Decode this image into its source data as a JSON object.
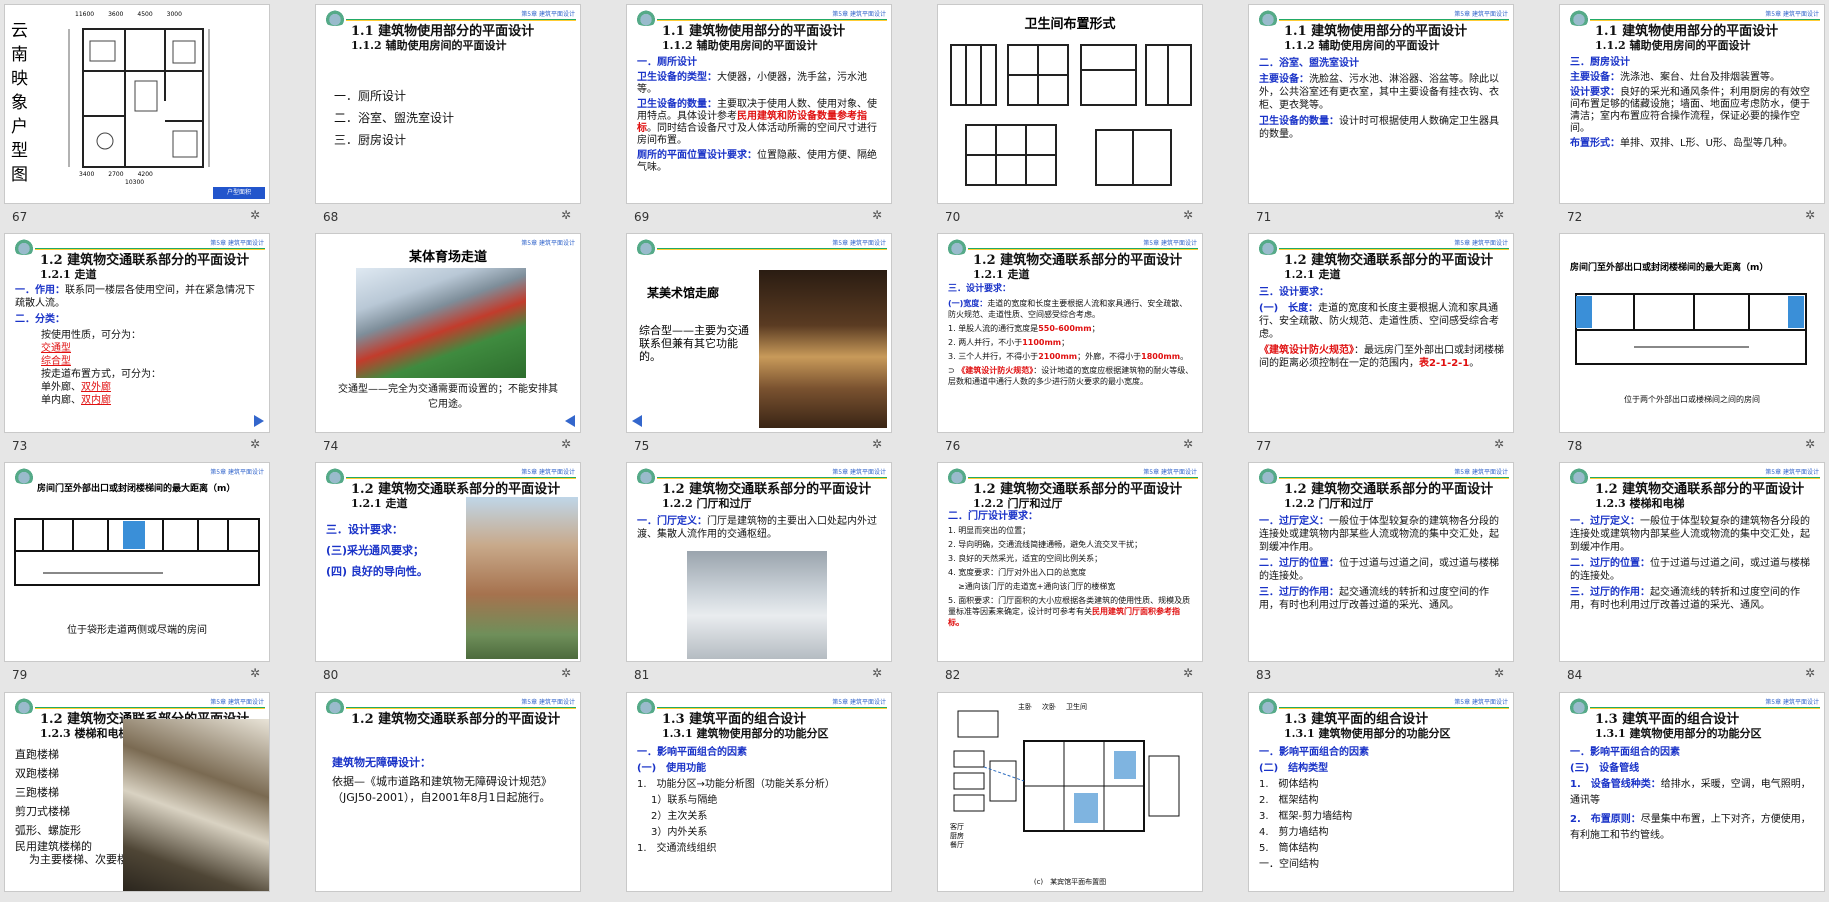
{
  "header_text": "第5章 建筑平面设计",
  "slides": {
    "s67": {
      "num": "67",
      "vtitle": "云南映象户型图",
      "dims_top": [
        "11600",
        "3600",
        "4500",
        "3000"
      ],
      "dims_bottom": [
        "3400",
        "2700",
        "4200",
        "10300"
      ],
      "badge": "户型面积"
    },
    "s68": {
      "num": "68",
      "t1": "1.1 建筑物使用部分的平面设计",
      "t2": "1.1.2 辅助使用房间的平面设计",
      "items": [
        "一．厕所设计",
        "二．浴室、盥洗室设计",
        "三．厨房设计"
      ]
    },
    "s69": {
      "num": "69",
      "t1": "1.1 建筑物使用部分的平面设计",
      "t2": "1.1.2 辅助使用房间的平面设计",
      "h": "一．厕所设计",
      "l1a": "卫生设备的类型：",
      "l1b": "大便器，小便器，洗手盆，污水池等。",
      "l2a": "卫生设备的数量：",
      "l2b": "主要取决于使用人数、使用对象、使用特点。具体设计参考",
      "l2c": "民用建筑和防设备数量参考指标",
      "l2d": "。同时结合设备尺寸及人体活动所需的空间尺寸进行房间布置。",
      "l3a": "厕所的平面位置设计要求：",
      "l3b": "位置隐蔽、使用方便、隔绝气味。"
    },
    "s70": {
      "num": "70",
      "title": "卫生间布置形式"
    },
    "s71": {
      "num": "71",
      "t1": "1.1 建筑物使用部分的平面设计",
      "t2": "1.1.2 辅助使用房间的平面设计",
      "h": "二．浴室、盥洗室设计",
      "l1a": "主要设备：",
      "l1b": "洗脸盆、污水池、淋浴器、浴盆等。除此以外，公共浴室还有更衣室，其中主要设备有挂衣钩、衣柜、更衣凳等。",
      "l2a": "卫生设备的数量：",
      "l2b": "设计时可根据使用人数确定卫生器具的数量。"
    },
    "s72": {
      "num": "72",
      "t1": "1.1 建筑物使用部分的平面设计",
      "t2": "1.1.2 辅助使用房间的平面设计",
      "h": "三．厨房设计",
      "l1a": "主要设备：",
      "l1b": "洗涤池、案台、灶台及排烟装置等。",
      "l2a": "设计要求：",
      "l2b": "良好的采光和通风条件；利用厨房的有效空间布置足够的储藏设施；墙面、地面应考虑防水，便于清洁；室内布置应符合操作流程，保证必要的操作空间。",
      "l3a": "布置形式：",
      "l3b": "单排、双排、L形、U形、岛型等几种。"
    },
    "s73": {
      "num": "73",
      "t1": "1.2 建筑物交通联系部分的平面设计",
      "t2": "1.2.1 走道",
      "h1": "一．作用：",
      "h1b": "联系同一楼层各使用空间，并在紧急情况下疏散人流。",
      "h2": "二．分类：",
      "p1": "按使用性质，可分为：",
      "a1": "交通型",
      "a2": "综合型",
      "p2": "按走道布置方式，可分为：",
      "p3a": "单外廊、",
      "p3b": "双外廊",
      "p4a": "单内廊、",
      "p4b": "双内廊"
    },
    "s74": {
      "num": "74",
      "title": "某体育场走道",
      "cap": "交通型——完全为交通需要而设置的；不能安排其它用途。"
    },
    "s75": {
      "num": "75",
      "title": "某美术馆走廊",
      "cap": "综合型——主要为交通联系但兼有其它功能的。"
    },
    "s76": {
      "num": "76",
      "t1": "1.2 建筑物交通联系部分的平面设计",
      "t2": "1.2.1 走道",
      "h": "三．设计要求：",
      "p0a": "(一)宽度：",
      "p0b": "走道的宽度和长度主要根据人流和家具通行、安全疏散、防火规范、走道性质、空间感受综合考虑。",
      "l1a": "单股人流的通行宽度是",
      "l1b": "550-600mm",
      "l1c": "；",
      "l2a": "两人并行，不小于",
      "l2b": "1100mm",
      "l2c": "；",
      "l3a": "三个人并行，不得小于",
      "l3b": "2100mm",
      "l3c": "；外廊，不得小于",
      "l3d": "1800mm",
      "l3e": "。",
      "n1a": "《建筑设计防火规范》",
      "n1b": "：设计地道的宽度应根据建筑物的耐火等级、层数和通道中通行人数的多少进行防火要求的最小宽度。"
    },
    "s77": {
      "num": "77",
      "t1": "1.2 建筑物交通联系部分的平面设计",
      "t2": "1.2.1 走道",
      "h": "三．设计要求：",
      "p1a": "(一)　长度：",
      "p1b": "走道的宽度和长度主要根据人流和家具通行、安全疏散、防火规范、走道性质、空间感受综合考虑。",
      "p2a": "《建筑设计防火规范》",
      "p2b": "：最远房门至外部出口或封闭楼梯间的距离必须控制在一定的范围内，",
      "p2c": "表2-1-2-1",
      "p2d": "。"
    },
    "s78": {
      "num": "78",
      "title": "房间门至外部出口或封闭楼梯间的最大距离（m）",
      "cap": "位于两个外部出口或楼梯间之间的房间"
    },
    "s79": {
      "num": "79",
      "title": "房间门至外部出口或封闭楼梯间的最大距离（m）",
      "cap": "位于袋形走道两侧或尽端的房间"
    },
    "s80": {
      "num": "80",
      "t1": "1.2 建筑物交通联系部分的平面设计",
      "t2": "1.2.1 走道",
      "h": "三．设计要求：",
      "p1": "(三)采光通风要求；",
      "p2": "(四) 良好的导向性。"
    },
    "s81": {
      "num": "81",
      "t1": "1.2 建筑物交通联系部分的平面设计",
      "t2": "1.2.2 门厅和过厅",
      "h": "一．门厅定义：",
      "hb": "门厅是建筑物的主要出入口处起内外过渡、集散人流作用的交通枢纽。"
    },
    "s82": {
      "num": "82",
      "t1": "1.2 建筑物交通联系部分的平面设计",
      "t2": "1.2.2 门厅和过厅",
      "h": "二．门厅设计要求：",
      "items": [
        "明显而突出的位置；",
        "导向明确，交通流线简捷通畅，避免人流交叉干扰；",
        "良好的天然采光，适宜的空间比例关系；",
        "宽度要求：门厅对外出入口的总宽度",
        "≥通向该门厅的走道宽+通向该门厅的楼梯宽",
        "面积要求：门厅面积的大小应根据各类建筑的使用性质、规模及质量标准等因素来确定，设计时可参考有关"
      ],
      "red": "民用建筑门厅面积参考指标。"
    },
    "s83": {
      "num": "83",
      "t1": "1.2 建筑物交通联系部分的平面设计",
      "t2": "1.2.2 门厅和过厅",
      "a1": "一．过厅定义：",
      "a1b": "一般位于体型较复杂的建筑物各分段的连接处或建筑物内部某些人流或物流的集中交汇处，起到缓冲作用。",
      "a2": "二．过厅的位置：",
      "a2b": "位于过道与过道之间，或过道与楼梯的连接处。",
      "a3": "三．过厅的作用：",
      "a3b": "起交通流线的转折和过度空间的作用，有时也利用过厅改善过道的采光、通风。"
    },
    "s84": {
      "num": "84",
      "t1": "1.2 建筑物交通联系部分的平面设计",
      "t2": "1.2.3 楼梯和电梯",
      "a1": "一．过厅定义：",
      "a1b": "一般位于体型较复杂的建筑物各分段的连接处或建筑物内部某些人流或物流的集中交汇处，起到缓冲作用。",
      "a2": "二．过厅的位置：",
      "a2b": "位于过道与过道之间，或过道与楼梯的连接处。",
      "a3": "三．过厅的作用：",
      "a3b": "起交通流线的转折和过度空间的作用，有时也利用过厅改善过道的采光、通风。"
    },
    "s85": {
      "t1": "1.2 建筑物交通联系部分的平面设计",
      "t2": "1.2.3 楼梯和电梯",
      "items": [
        "直跑楼梯",
        "双跑楼梯",
        "三跑楼梯",
        "剪刀式楼梯",
        "弧形、螺旋形",
        "民用建筑楼梯的",
        "为主要楼梯、次要楼"
      ]
    },
    "s86": {
      "t1": "1.2 建筑物交通联系部分的平面设计",
      "h": "建筑物无障碍设计：",
      "p": "依据—《城市道路和建筑物无障碍设计规范》（JGJ50-2001），自2001年8月1日起施行。"
    },
    "s87": {
      "t1": "1.3 建筑平面的组合设计",
      "t2": "1.3.1 建筑物使用部分的功能分区",
      "h": "一．影响平面组合的因素",
      "h2": "(一)　使用功能",
      "items": [
        "1.　功能分区→功能分析图（功能关系分析）",
        "1）联系与隔绝",
        "2）主次关系",
        "3）内外关系",
        "1.　交通流线组织"
      ]
    },
    "s88": {
      "labels": [
        "客厅",
        "厨房",
        "餐厅",
        "主卧",
        "次卧",
        "卫生间"
      ],
      "cap": "(c)　某宾馆平面布置图"
    },
    "s89": {
      "t1": "1.3 建筑平面的组合设计",
      "t2": "1.3.1 建筑物使用部分的功能分区",
      "h": "一．影响平面组合的因素",
      "h2": "(二)　结构类型",
      "items": [
        "1.　砌体结构",
        "2.　框架结构",
        "3.　框架-剪力墙结构",
        "4.　剪力墙结构",
        "5.　筒体结构",
        "一．空间结构"
      ]
    },
    "s90": {
      "t1": "1.3 建筑平面的组合设计",
      "t2": "1.3.1 建筑物使用部分的功能分区",
      "h": "一．影响平面组合的因素",
      "h2": "(三)　设备管线",
      "a1": "1.　设备管线种类：",
      "a1b": "给排水，采暖，空调，电气照明，通讯等",
      "a2": "2.　布置原则：",
      "a2b": "尽量集中布置，上下对齐，方便使用，有利施工和节约管线。"
    }
  }
}
